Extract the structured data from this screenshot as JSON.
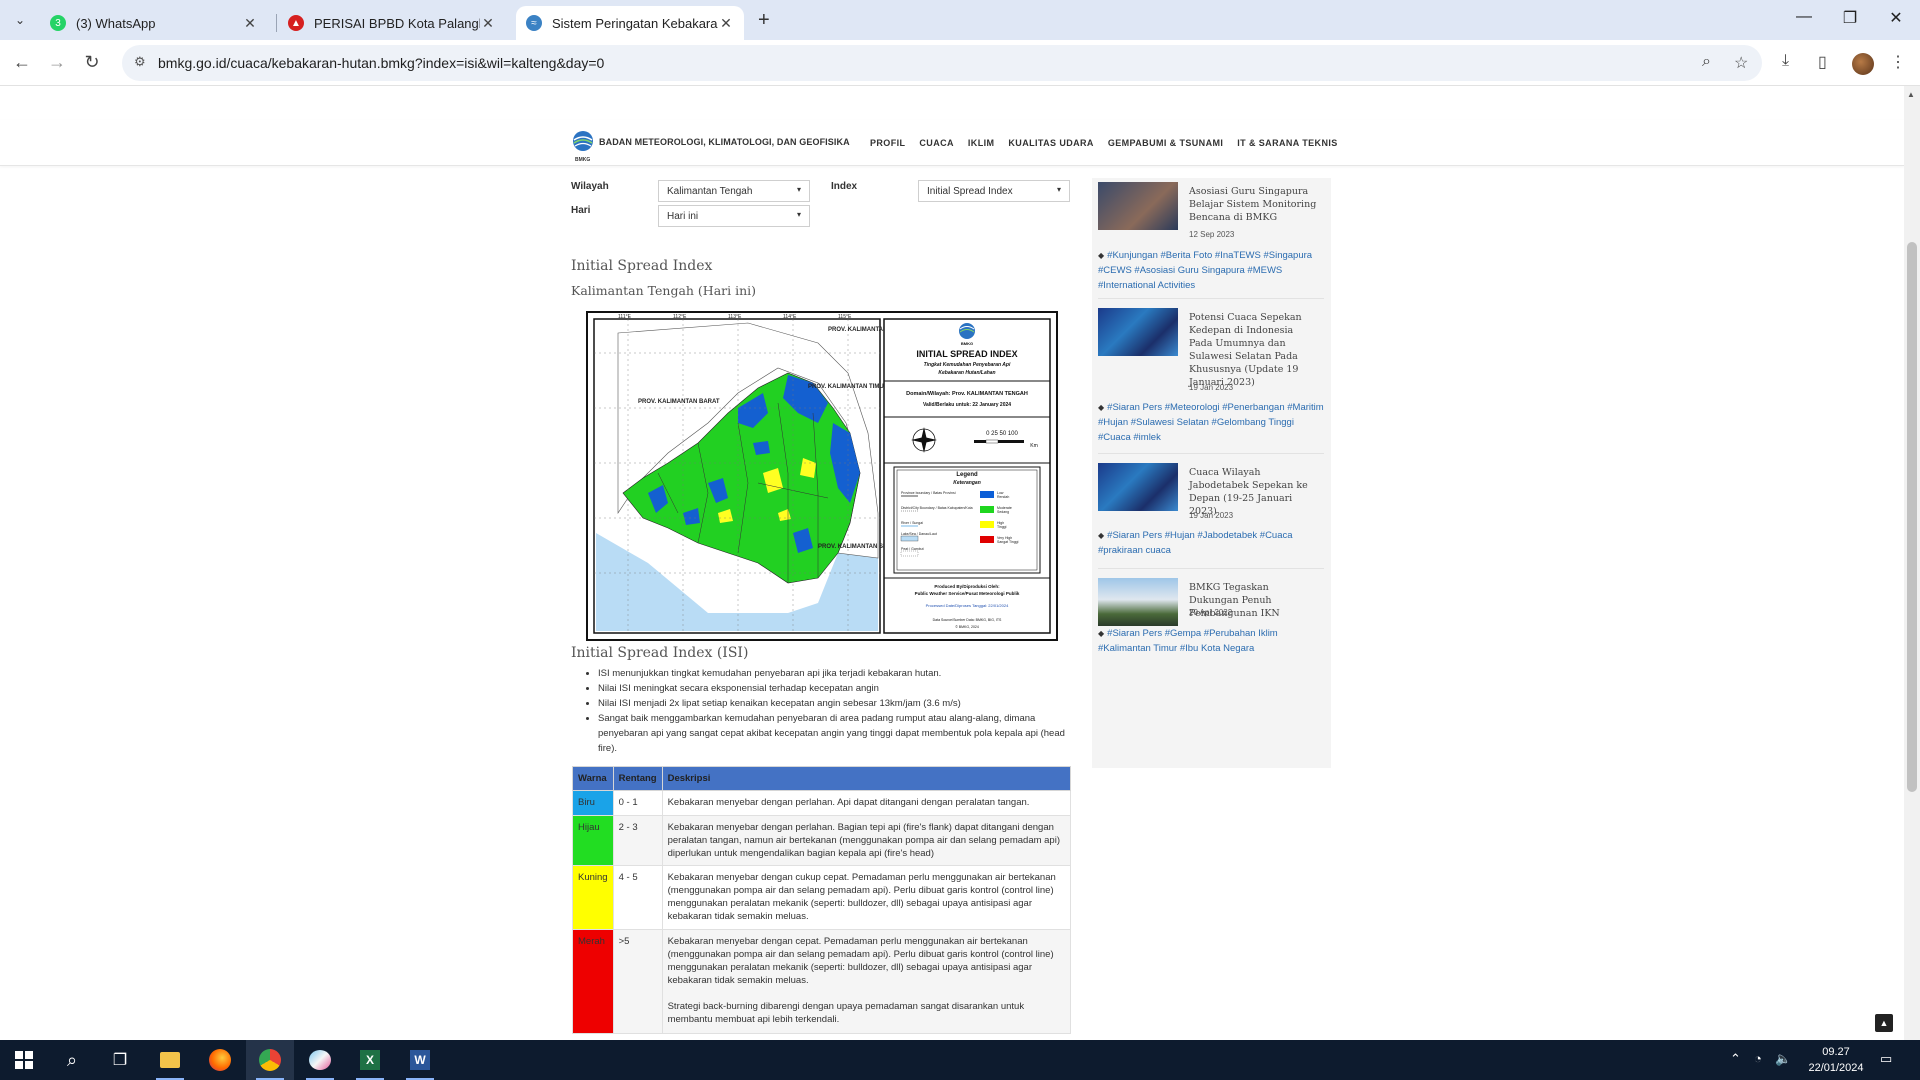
{
  "browser": {
    "tabs": [
      {
        "title": "(3) WhatsApp",
        "badge": "3"
      },
      {
        "title": "PERISAI BPBD Kota Palangka Raya"
      },
      {
        "title": "Sistem Peringatan Kebakaran Hutan"
      }
    ],
    "url": "bmkg.go.id/cuaca/kebakaran-hutan.bmkg?index=isi&wil=kalteng&day=0"
  },
  "header": {
    "logo_text": "BADAN METEOROLOGI, KLIMATOLOGI, DAN GEOFISIKA",
    "logo_caption": "BMKG",
    "nav": [
      "PROFIL",
      "CUACA",
      "IKLIM",
      "KUALITAS UDARA",
      "GEMPABUMI & TSUNAMI",
      "IT & SARANA TEKNIS"
    ]
  },
  "form": {
    "wilayah_label": "Wilayah",
    "wilayah_value": "Kalimantan Tengah",
    "hari_label": "Hari",
    "hari_value": "Hari ini",
    "index_label": "Index",
    "index_value": "Initial Spread Index"
  },
  "main": {
    "title": "Initial Spread Index",
    "subtitle": "Kalimantan Tengah (Hari ini)",
    "section_title": "Initial Spread Index (ISI)",
    "bullets": [
      "ISI menunjukkan tingkat kemudahan penyebaran api jika terjadi kebakaran hutan.",
      "Nilai ISI meningkat secara eksponensial terhadap kecepatan angin",
      "Nilai ISI menjadi 2x lipat setiap kenaikan kecepatan angin sebesar 13km/jam (3.6 m/s)",
      "Sangat baik menggambarkan kemudahan penyebaran di area padang rumput atau alang-alang, dimana penyebaran api yang sangat cepat akibat kecepatan angin yang tinggi dapat membentuk pola kepala api (head fire)."
    ]
  },
  "map": {
    "title": "INITIAL SPREAD INDEX",
    "subtitle1": "Tingkat Kemudahan Penyebaran Api",
    "subtitle2": "Kebakaran Hutan/Lahan",
    "domain": "Domain/Wilayah: Prov. KALIMANTAN TENGAH",
    "valid": "Valid/Berlaku untuk: 22 January 2024",
    "scale": "0  25 50     100",
    "scale_unit": "Km",
    "bmkg": "BMKG",
    "legend_title": "Legend",
    "legend_subtitle": "Keterangan",
    "legend_left": [
      "Province boundary / Batas Provinsi",
      "District/City Boundary / Batas Kabupaten/Kota",
      "River / Sungai",
      "Lake/Sea / Danau/Laut",
      "Peat / Gambut"
    ],
    "legend_right": [
      {
        "label": "Low",
        "sub": "Rendah",
        "color": "#0b5ed7"
      },
      {
        "label": "Moderate",
        "sub": "Sedang",
        "color": "#1fd61f"
      },
      {
        "label": "High",
        "sub": "Tinggi",
        "color": "#ffff00"
      },
      {
        "label": "Very High",
        "sub": "Sangat Tinggi",
        "color": "#e00000"
      }
    ],
    "produced_by": "Produced By/Diproduksi Oleh:",
    "produced_by2": "Public Weather Service/Pusat Meteorologi Publik",
    "processed": "Processed Date/Diproses Tanggal: 22/01/2024",
    "source": "Data Source/Sumber Data: BMKG, BIG, ITS",
    "copyright": "© BMKG, 2024",
    "labels": [
      "PROV. KALIMANTAN UTARA",
      "PROV. KALIMANTAN BARAT",
      "PROV. KALIMANTAN TIMUR",
      "PROV. KALIMANTAN SELATAN"
    ],
    "lon_ticks": [
      "111°E",
      "112°E",
      "113°E",
      "114°E",
      "115°E"
    ]
  },
  "legend_table": {
    "headers": [
      "Warna",
      "Rentang",
      "Deskripsi"
    ],
    "rows": [
      {
        "warna": "Biru",
        "color": "#1aa3e8",
        "rentang": "0 - 1",
        "desc": "Kebakaran menyebar dengan perlahan. Api dapat ditangani dengan peralatan tangan."
      },
      {
        "warna": "Hijau",
        "color": "#22dd22",
        "rentang": "2 - 3",
        "desc": "Kebakaran menyebar dengan perlahan. Bagian tepi api (fire's flank) dapat ditangani dengan peralatan tangan, namun air bertekanan (menggunakan pompa air dan selang pemadam api) diperlukan untuk mengendalikan bagian kepala api (fire's head)"
      },
      {
        "warna": "Kuning",
        "color": "#ffff00",
        "rentang": "4 - 5",
        "desc": "Kebakaran menyebar dengan cukup cepat. Pemadaman perlu menggunakan air bertekanan (menggunakan pompa air dan selang pemadam api). Perlu dibuat garis kontrol (control line) menggunakan peralatan mekanik (seperti: bulldozer, dll) sebagai upaya antisipasi agar kebakaran tidak semakin meluas."
      },
      {
        "warna": "Merah",
        "color": "#ee0000",
        "rentang": ">5",
        "desc": "Kebakaran menyebar dengan cepat. Pemadaman perlu menggunakan air bertekanan (menggunakan pompa air dan selang pemadam api). Perlu dibuat garis kontrol (control line) menggunakan peralatan mekanik (seperti: bulldozer, dll) sebagai upaya antisipasi agar kebakaran tidak semakin meluas.",
        "desc2": "Strategi back-burning dibarengi dengan upaya pemadaman sangat disarankan untuk membantu membuat api lebih terkendali."
      }
    ]
  },
  "sidebar": {
    "news": [
      {
        "title": "Asosiasi Guru Singapura Belajar Sistem Monitoring Bencana di BMKG",
        "date": "12 Sep 2023",
        "tags": "#Kunjungan #Berita Foto #InaTEWS #Singapura #CEWS #Asosiasi Guru Singapura #MEWS #International Activities"
      },
      {
        "title": "Potensi Cuaca Sepekan Kedepan di Indonesia Pada Umumnya dan Sulawesi Selatan Pada Khususnya (Update 19 Januari 2023)",
        "date": "19 Jan 2023",
        "tags": "#Siaran Pers #Meteorologi #Penerbangan #Maritim #Hujan #Sulawesi Selatan #Gelombang Tinggi #Cuaca #imlek"
      },
      {
        "title": "Cuaca Wilayah Jabodetabek Sepekan ke Depan (19-25 Januari 2023)",
        "date": "19 Jan 2023",
        "tags": "#Siaran Pers #Hujan #Jabodetabek #Cuaca #prakiraan cuaca"
      },
      {
        "title": "BMKG Tegaskan Dukungan Penuh Pembangunan IKN",
        "date": "20 Apr 2022",
        "tags": "#Siaran Pers #Gempa #Perubahan Iklim #Kalimantan Timur #Ibu Kota Negara"
      }
    ]
  },
  "taskbar": {
    "time": "09.27",
    "date": "22/01/2024"
  }
}
